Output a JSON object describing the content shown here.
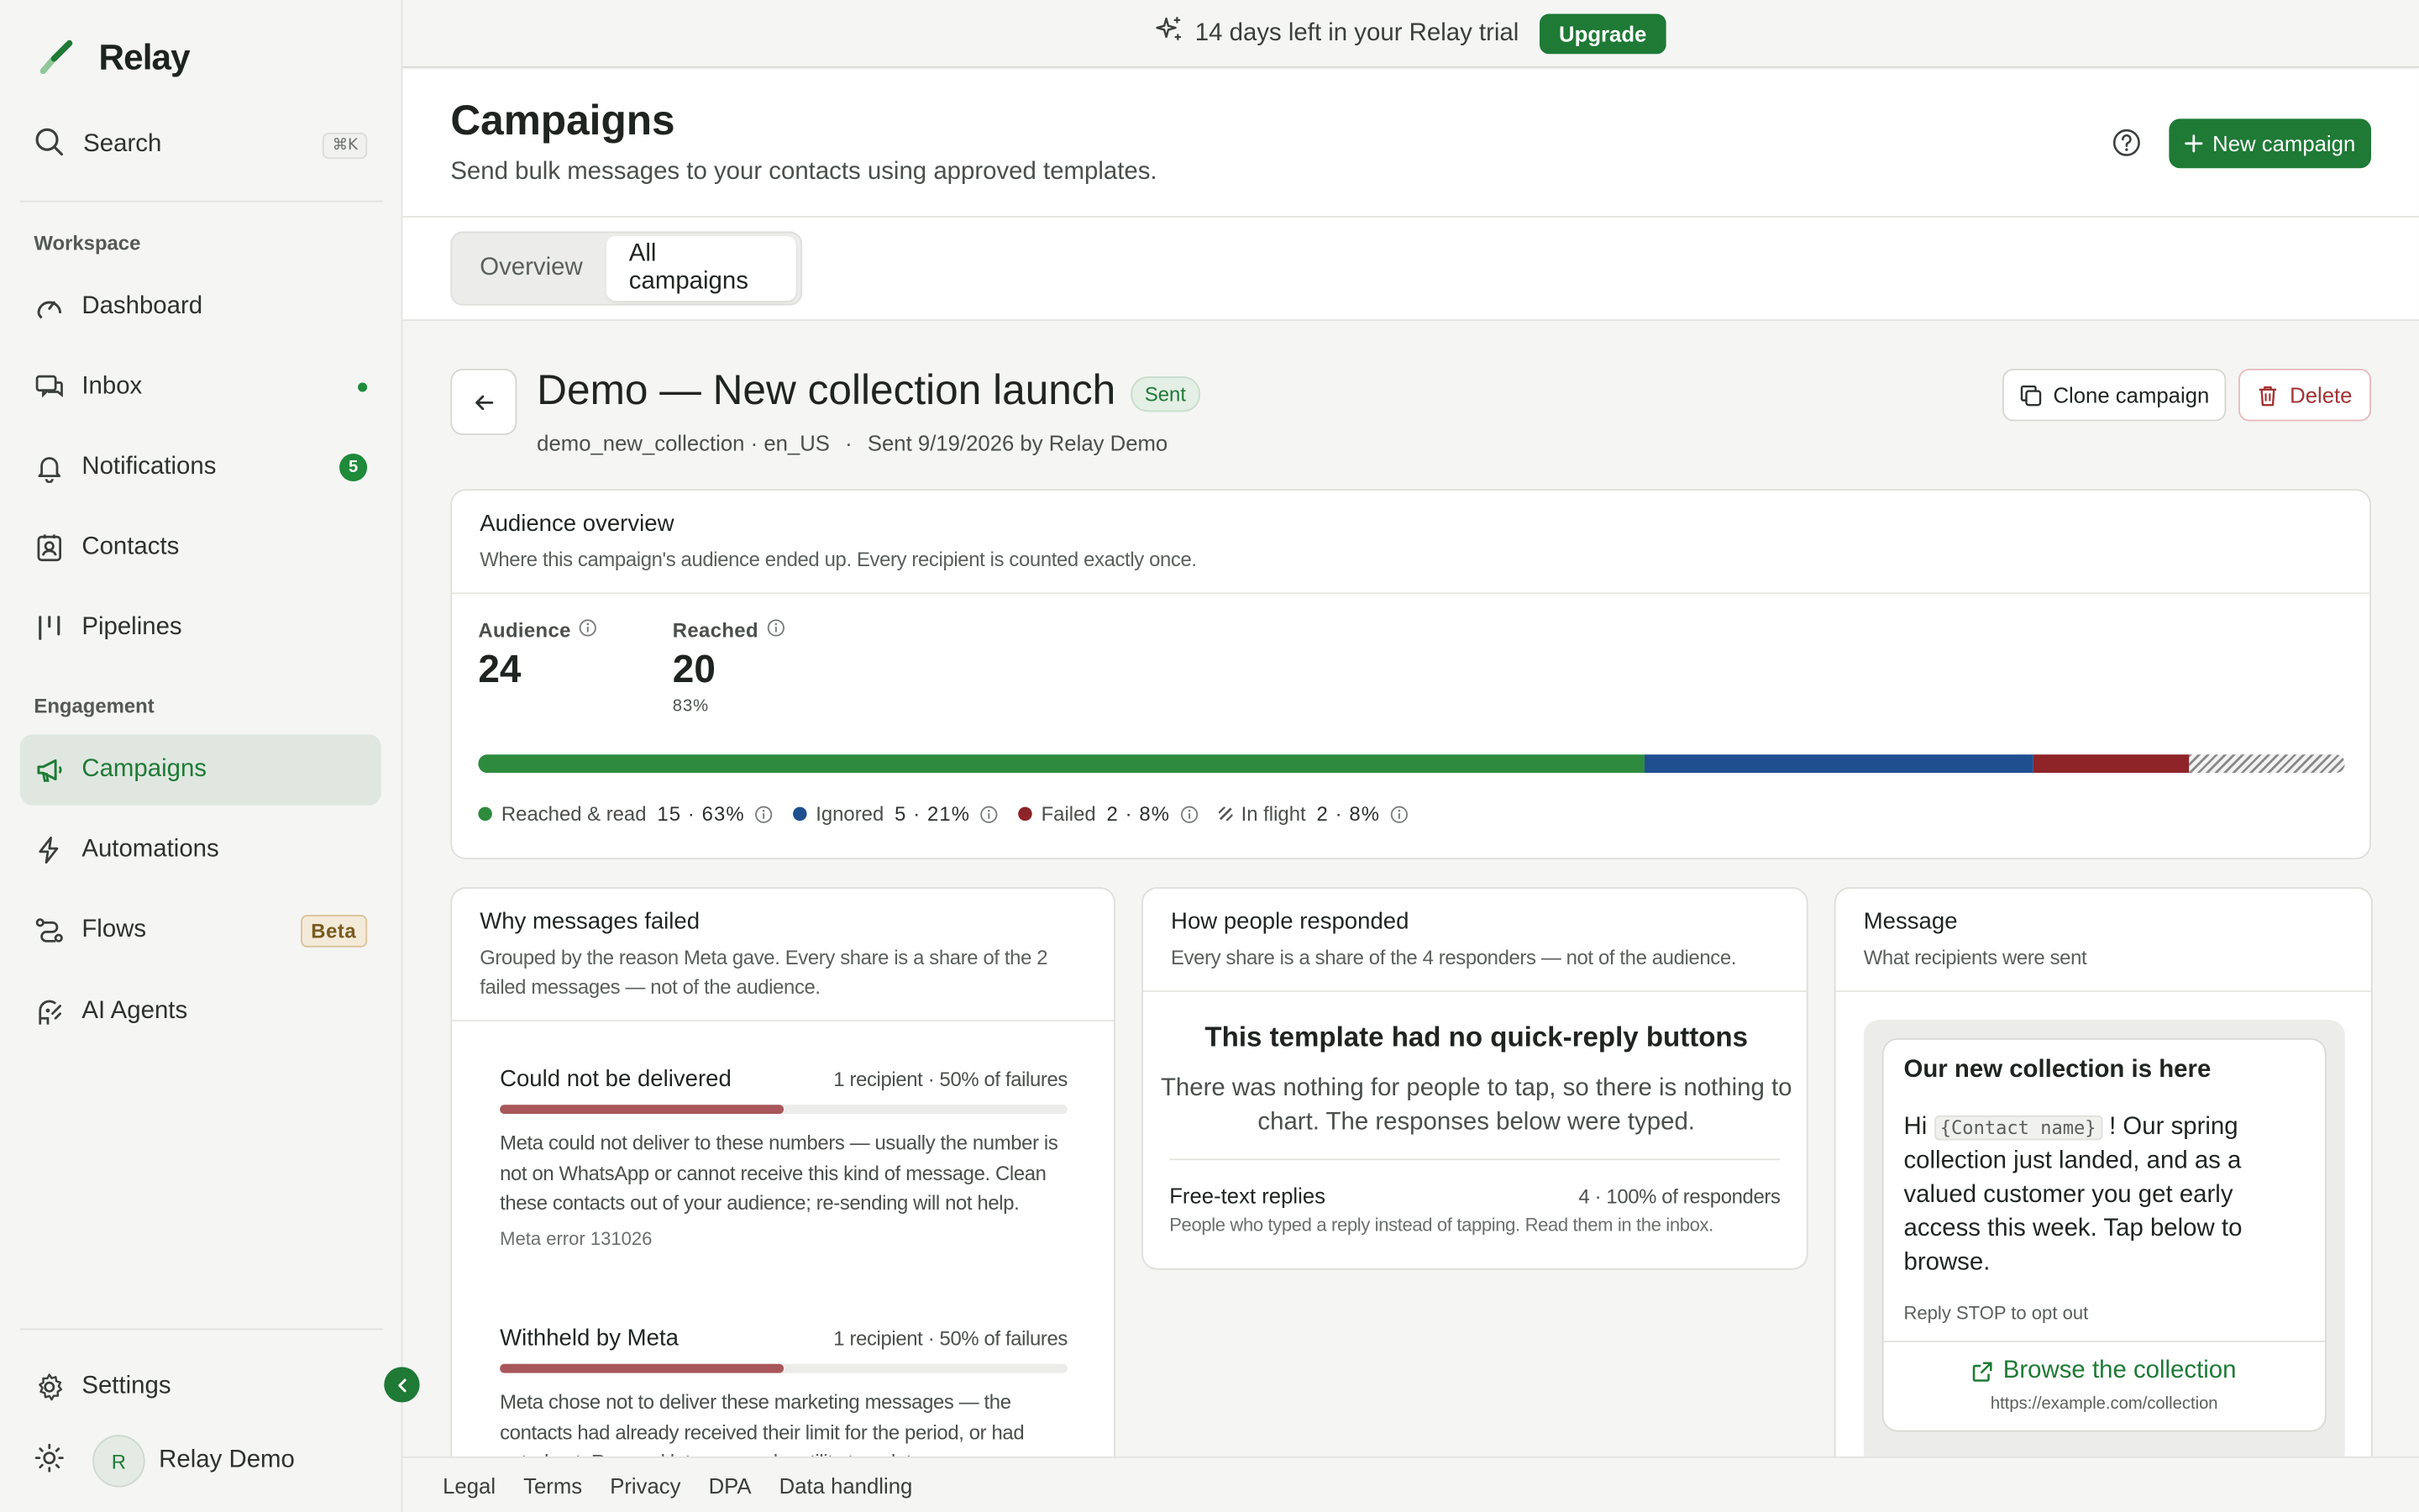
{
  "app": {
    "name": "Relay"
  },
  "sidebar": {
    "search_label": "Search",
    "search_shortcut": "⌘K",
    "workspace_label": "Workspace",
    "engagement_label": "Engagement",
    "items": [
      {
        "label": "Dashboard",
        "icon": "gauge-icon"
      },
      {
        "label": "Inbox",
        "icon": "inbox-icon"
      },
      {
        "label": "Notifications",
        "icon": "bell-icon",
        "badge": "5"
      },
      {
        "label": "Contacts",
        "icon": "contact-card-icon"
      },
      {
        "label": "Pipelines",
        "icon": "kanban-icon"
      },
      {
        "label": "Campaigns",
        "icon": "megaphone-icon",
        "active": true
      },
      {
        "label": "Automations",
        "icon": "lightning-icon"
      },
      {
        "label": "Flows",
        "icon": "flow-icon",
        "badge": "Beta"
      },
      {
        "label": "AI Agents",
        "icon": "ai-agent-icon"
      }
    ],
    "settings_label": "Settings",
    "user": {
      "initial": "R",
      "name": "Relay Demo"
    }
  },
  "banner": {
    "text": "14 days left in your Relay trial",
    "upgrade_label": "Upgrade"
  },
  "header": {
    "title": "Campaigns",
    "subtitle": "Send bulk messages to your contacts using approved templates.",
    "new_label": "New campaign"
  },
  "tabs": [
    {
      "label": "Overview"
    },
    {
      "label": "All campaigns",
      "active": true
    }
  ],
  "campaign": {
    "title": "Demo — New collection launch",
    "status": "Sent",
    "template": "demo_new_collection · en_US",
    "separator": "·",
    "sent_info": "Sent 9/19/2026 by Relay Demo",
    "clone_label": "Clone campaign",
    "delete_label": "Delete"
  },
  "audience": {
    "title": "Audience overview",
    "subtitle": "Where this campaign's audience ended up. Every recipient is counted exactly once.",
    "audience_label": "Audience",
    "audience_value": "24",
    "reached_label": "Reached",
    "reached_value": "20",
    "reached_pct": "83%",
    "segments": [
      {
        "label": "Reached & read",
        "value": "15 · 63%",
        "share": 0.625,
        "color": "#2e8b3e"
      },
      {
        "label": "Ignored",
        "value": "5 · 21%",
        "share": 0.2083,
        "color": "#1f4f8f"
      },
      {
        "label": "Failed",
        "value": "2 · 8%",
        "share": 0.0833,
        "color": "#8e2428"
      },
      {
        "label": "In flight",
        "value": "2 · 8%",
        "share": 0.0833,
        "color": "hatched"
      }
    ]
  },
  "failures": {
    "title": "Why messages failed",
    "subtitle": "Grouped by the reason Meta gave. Every share is a share of the 2 failed messages — not of the audience.",
    "reasons": [
      {
        "title": "Could not be delivered",
        "count": "1 recipient · 50% of failures",
        "share": 0.5,
        "description": "Meta could not deliver to these numbers — usually the number is not on WhatsApp or cannot receive this kind of message. Clean these contacts out of your audience; re-sending will not help.",
        "code": "Meta error 131026"
      },
      {
        "title": "Withheld by Meta",
        "count": "1 recipient · 50% of failures",
        "share": 0.5,
        "description": "Meta chose not to deliver these marketing messages — the contacts had already received their limit for the period, or had opted out. Re-send later or send a utility template."
      }
    ]
  },
  "responses": {
    "title": "How people responded",
    "subtitle": "Every share is a share of the 4 responders — not of the audience.",
    "empty_title": "This template had no quick-reply buttons",
    "empty_text": "There was nothing for people to tap, so there is nothing to chart. The responses below were typed.",
    "free_title": "Free-text replies",
    "free_count": "4 · 100% of responders",
    "free_sub": "People who typed a reply instead of tapping. Read them in the inbox."
  },
  "message": {
    "title": "Message",
    "subtitle": "What recipients were sent",
    "bubble_title": "Our new collection is here",
    "body_prefix": "Hi",
    "placeholder": "{Contact name}",
    "body_suffix": "! Our spring collection just landed, and as a valued customer you get early access this week. Tap below to browse.",
    "footer": "Reply STOP to opt out",
    "button_label": "Browse the collection",
    "button_url": "https://example.com/collection"
  },
  "footer_links": [
    "Legal",
    "Terms",
    "Privacy",
    "DPA",
    "Data handling"
  ],
  "colors": {
    "accent": "#1e7a35",
    "danger": "#a33535",
    "failure_bar": "#a85659"
  }
}
